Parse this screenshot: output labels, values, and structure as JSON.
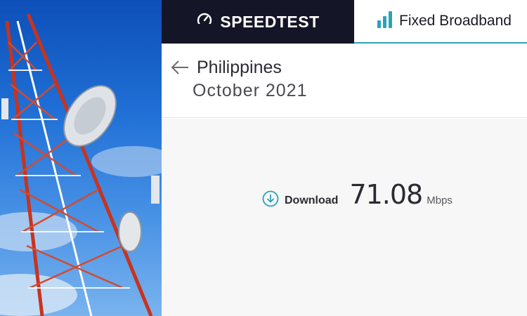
{
  "header": {
    "brand_label": "SPEEDTEST",
    "tab_label": "Fixed Broadband"
  },
  "report": {
    "country": "Philippines",
    "period": "October 2021"
  },
  "metric": {
    "label": "Download",
    "value": "71.08",
    "unit": "Mbps"
  },
  "icons": {
    "brand": "speedometer-icon",
    "tab": "signal-bars-icon",
    "back": "back-arrow-icon",
    "download": "download-circle-icon"
  },
  "colors": {
    "brand_bg": "#141526",
    "accent": "#2aa3b8",
    "text_dark": "#2a2a33"
  }
}
